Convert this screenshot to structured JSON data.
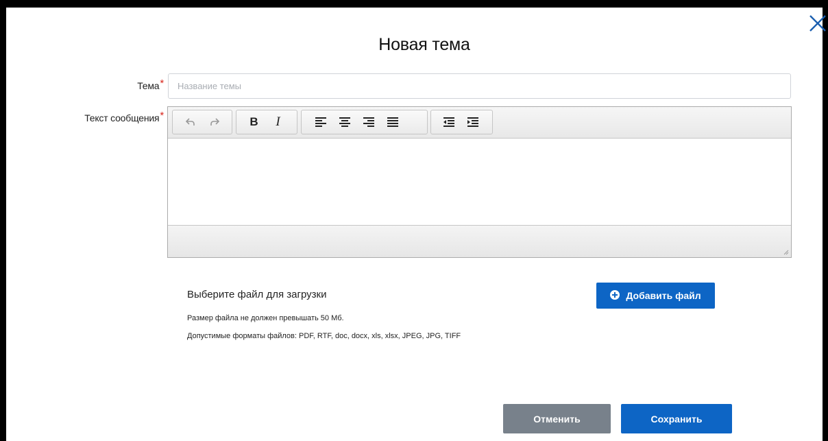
{
  "dialog": {
    "title": "Новая тема",
    "close_icon": "close-icon"
  },
  "form": {
    "topic_label": "Тема",
    "topic_placeholder": "Название темы",
    "topic_value": "",
    "message_label": "Текст сообщения",
    "required_mark": "*"
  },
  "editor": {
    "toolbar": [
      {
        "group": "history",
        "buttons": [
          "undo-icon",
          "redo-icon"
        ]
      },
      {
        "group": "formatting",
        "buttons": [
          "B",
          "I"
        ]
      },
      {
        "group": "alignment",
        "buttons": [
          "align-left-icon",
          "align-center-icon",
          "align-right-icon",
          "align-justify-icon"
        ]
      },
      {
        "group": "indent",
        "buttons": [
          "outdent-icon",
          "indent-icon"
        ]
      }
    ],
    "bold_label": "B",
    "italic_label": "I",
    "content": ""
  },
  "upload": {
    "title": "Выберите файл для загрузки",
    "size_note": "Размер файла не должен превышать 50 Мб.",
    "formats_note": "Допустимые форматы файлов: PDF, RTF, doc, docx, xls, xlsx, JPEG, JPG, TIFF",
    "add_button": "Добавить файл"
  },
  "actions": {
    "cancel": "Отменить",
    "save": "Сохранить"
  },
  "colors": {
    "primary": "#0d65c5",
    "secondary": "#78818b",
    "required": "#d9261c"
  }
}
